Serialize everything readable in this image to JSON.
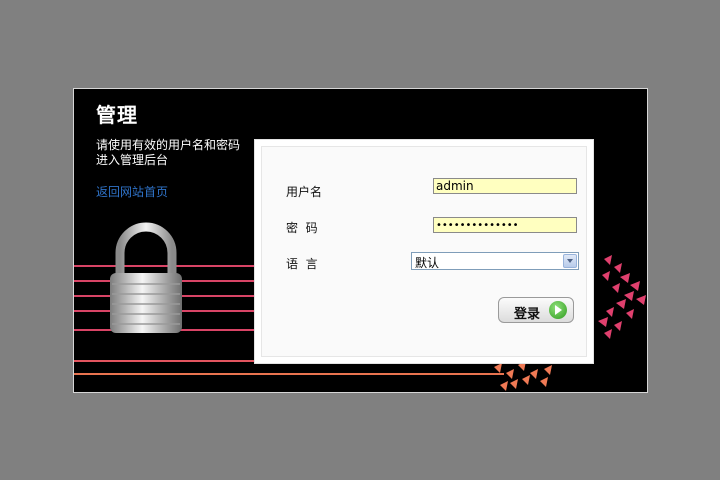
{
  "header": {
    "title": "管理",
    "description_line1": "请使用有效的用户名和密码",
    "description_line2": "进入管理后台",
    "back_link": "返回网站首页"
  },
  "form": {
    "username_label": "用户名",
    "username_value": "admin",
    "password_label": "密  码",
    "password_value": "••••••••••••••",
    "language_label": "语  言",
    "language_value": "默认",
    "login_label": "登录"
  },
  "colors": {
    "page_bg": "#808080",
    "panel_bg": "#000000",
    "input_bg": "#ffffc0",
    "link": "#2f73c9",
    "accent_pink": "#e04a73",
    "accent_orange": "#f07a55"
  },
  "icons": [
    "padlock-icon",
    "go-arrow-icon",
    "dropdown-arrow-icon"
  ]
}
